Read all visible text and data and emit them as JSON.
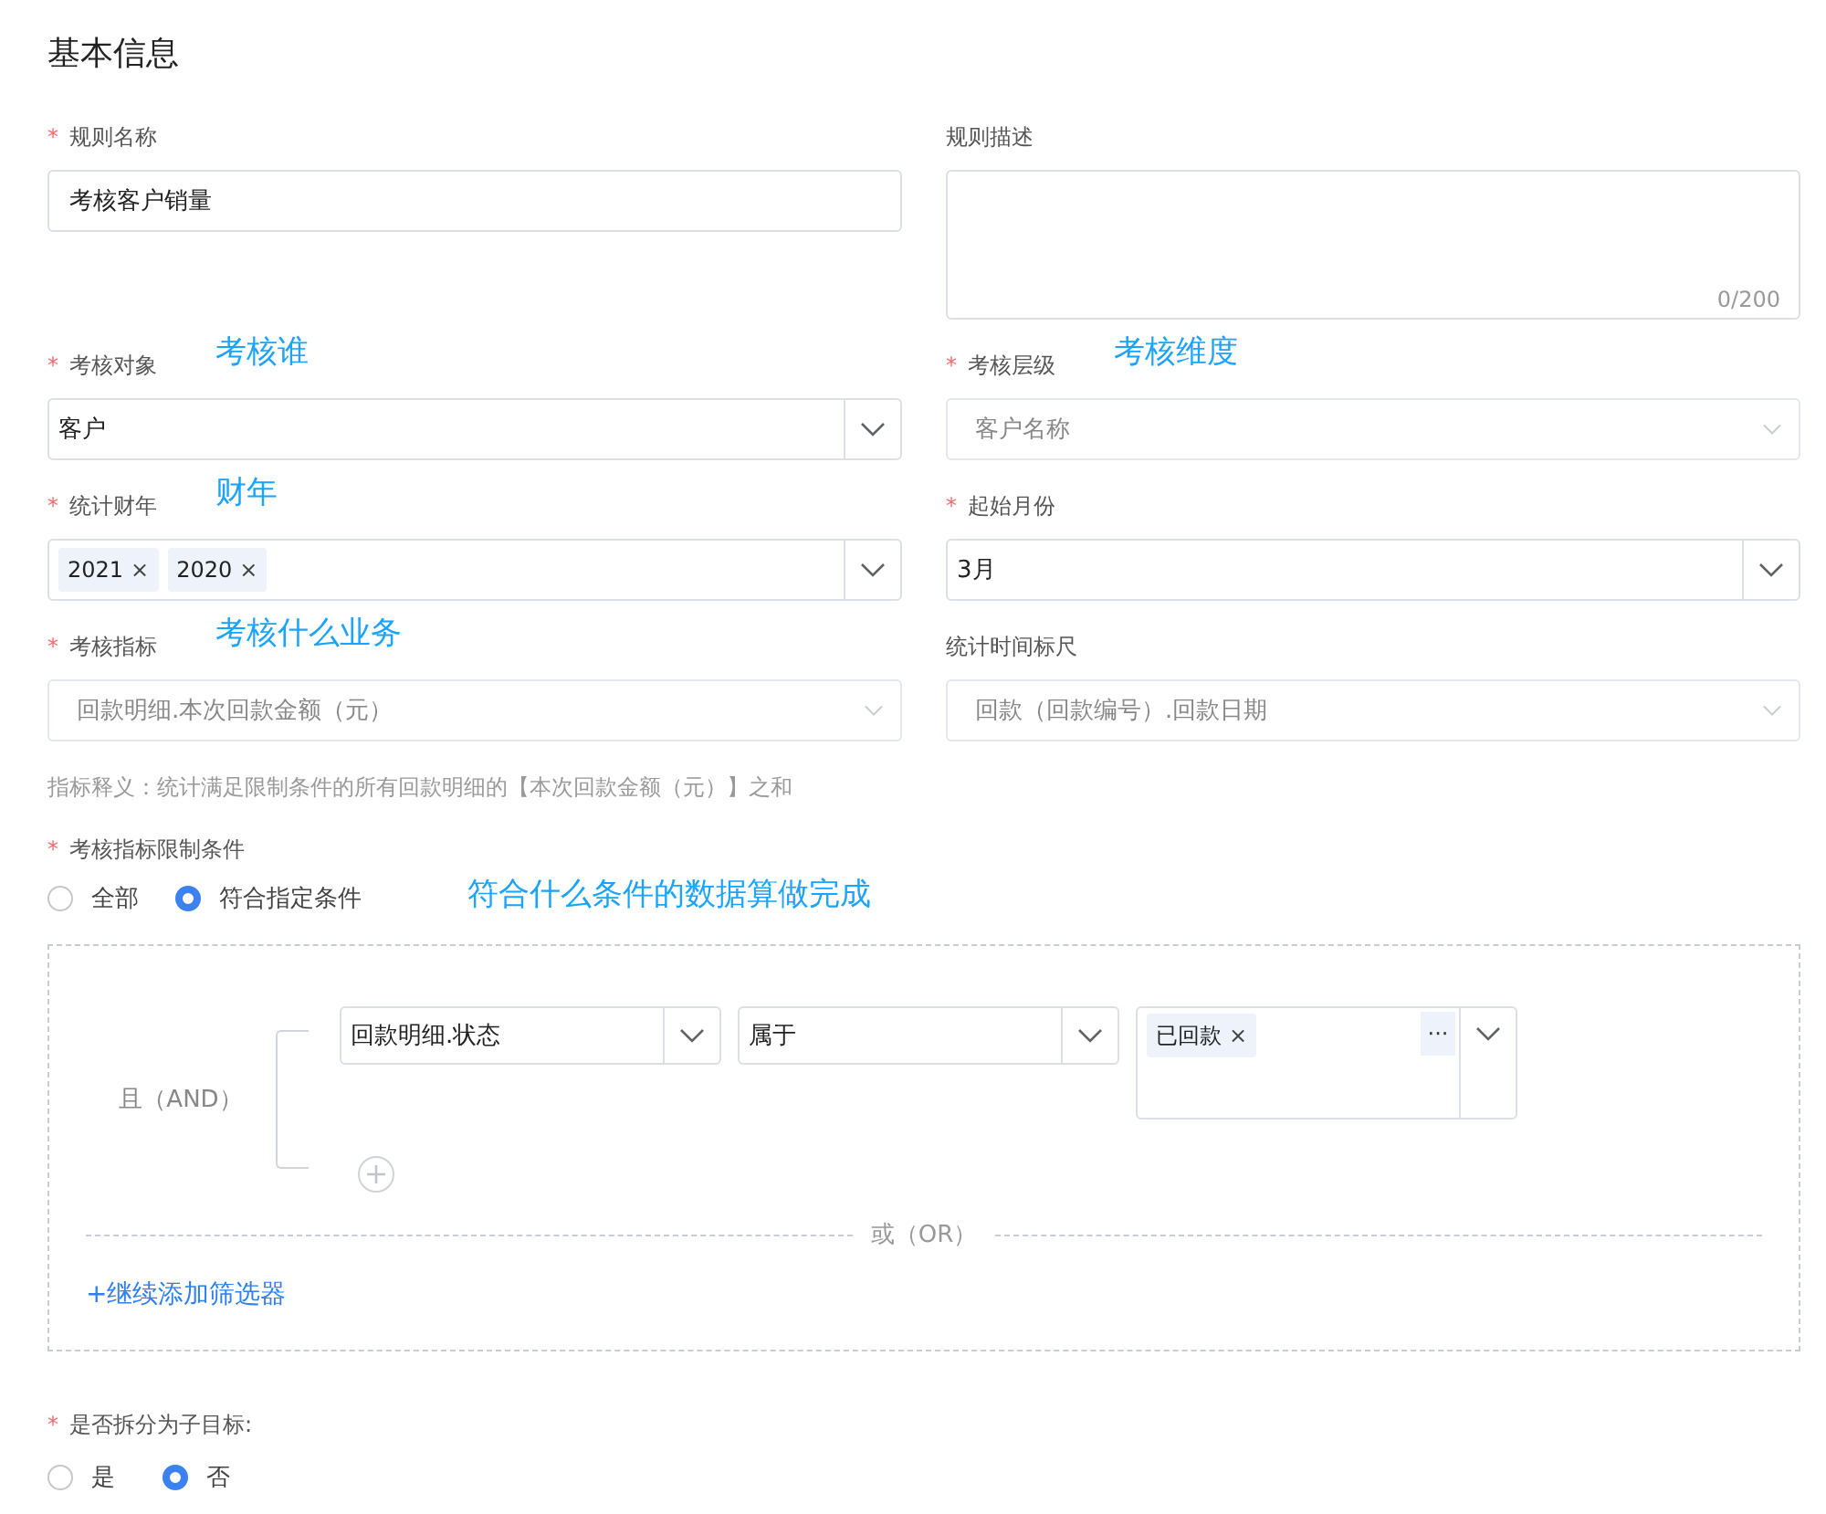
{
  "title": "基本信息",
  "fields": [
    {
      "label": "规则名称",
      "required_mark": "*",
      "kind": "input",
      "value": "考核客户销量"
    },
    {
      "label": "规则描述",
      "kind": "textarea",
      "counter": "0/200"
    },
    {
      "label": "考核对象",
      "required_mark": "*",
      "annotation": "考核谁",
      "kind": "select",
      "value": "客户",
      "disabled": false
    },
    {
      "label": "考核层级",
      "required_mark": "*",
      "annotation": "考核维度",
      "kind": "select",
      "value": "客户名称",
      "disabled": true
    },
    {
      "label": "统计财年",
      "required_mark": "*",
      "annotation": "财年",
      "kind": "tags",
      "tags": [
        {
          "text": "2021",
          "remove": "×"
        },
        {
          "text": "2020",
          "remove": "×"
        }
      ]
    },
    {
      "label": "起始月份",
      "required_mark": "*",
      "kind": "select",
      "value": "3月",
      "disabled": false
    },
    {
      "label": "考核指标",
      "required_mark": "*",
      "annotation": "考核什么业务",
      "kind": "select",
      "value": "回款明细.本次回款金额（元）",
      "disabled": true
    },
    {
      "label": "统计时间标尺",
      "kind": "select",
      "value": "回款（回款编号）.回款日期",
      "disabled": true
    }
  ],
  "hint": "指标释义：统计满足限制条件的所有回款明细的【本次回款金额（元）】之和",
  "conditions": {
    "label": "考核指标限制条件",
    "required_mark": "*",
    "annotation": "符合什么条件的数据算做完成",
    "radios": [
      {
        "label": "全部",
        "selected": false
      },
      {
        "label": "符合指定条件",
        "selected": true
      }
    ],
    "group_label": "且（AND）",
    "rows": [
      {
        "field": "回款明细.状态",
        "operator": "属于",
        "values": [
          {
            "text": "已回款",
            "remove": "×"
          }
        ],
        "more": "···"
      }
    ],
    "or_label": "或（OR）",
    "add_filter": "+继续添加筛选器"
  },
  "subgoal": {
    "label": "是否拆分为子目标:",
    "required_mark": "*",
    "radios": [
      {
        "label": "是",
        "selected": false
      },
      {
        "label": "否",
        "selected": true
      }
    ]
  }
}
